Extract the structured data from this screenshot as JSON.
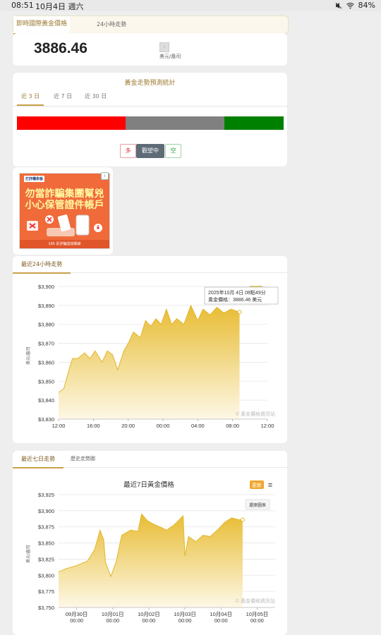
{
  "status_bar": {
    "time": "08:51",
    "date": "10月4日 週六",
    "battery": "84%"
  },
  "top_tabs": {
    "active": "即時國際黃金價格",
    "inactive": "24小時走勢"
  },
  "price": {
    "value": "3886.46",
    "unit": "美元/盎司",
    "unit_button": "›"
  },
  "prediction": {
    "title": "黃金走勢預測統計",
    "tabs": [
      "近 3 日",
      "近 7 日",
      "近 30 日"
    ],
    "active_tab": "近 3 日",
    "bar_colors": {
      "long": "#ff0000",
      "watch": "#808080",
      "short": "#008000"
    },
    "sentiment_buttons": {
      "long": "多",
      "watch": "觀望中",
      "short": "空"
    }
  },
  "ad": {
    "info_icon": "i",
    "top_text": "打詐儀表板",
    "headline_line1": "勿當詐騙集團幫兇",
    "headline_line2": "小心保管證件帳戶",
    "footer": "165 反詐騙諮詢專線"
  },
  "chart24": {
    "tab_label": "最近24小時走勢",
    "tooltip_line1": "2025年10月 4日 08點49分",
    "tooltip_line2": "黃金價格：3886.46 美元",
    "watermark": "© 黃金價格資訊站",
    "ylabel": "美元/盎司"
  },
  "chart7": {
    "tab_label": "最近七日走勢",
    "tab_label2": "歷史走勢圖",
    "title": "最近7日黃金價格",
    "update_button": "更新",
    "menu_icon": "≡",
    "reset_button": "還原圖表",
    "watermark": "© 黃金價格資訊站",
    "ylabel": "美元/盎司"
  },
  "chart_data": [
    {
      "type": "area",
      "ylim": [
        3830,
        3900
      ],
      "yticks": [
        "$3,830",
        "$3,840",
        "$3,850",
        "$3,860",
        "$3,870",
        "$3,880",
        "$3,890",
        "$3,900"
      ],
      "xlim": [
        0,
        24
      ],
      "xticks": [
        {
          "pos": 0,
          "label": "12:00"
        },
        {
          "pos": 4,
          "label": "16:00"
        },
        {
          "pos": 8,
          "label": "20:00"
        },
        {
          "pos": 12,
          "label": "00:00"
        },
        {
          "pos": 16,
          "label": "04:00"
        },
        {
          "pos": 20,
          "label": "08:00"
        },
        {
          "pos": 24,
          "label": "12:00"
        }
      ],
      "series": [
        {
          "x": [
            0,
            0.6,
            1.2,
            1.6,
            2.2,
            3,
            3.6,
            4.2,
            5,
            5.6,
            6.2,
            6.8,
            7.5,
            8,
            8.6,
            9.4,
            10,
            10.6,
            11.2,
            11.8,
            12.4,
            13,
            13.6,
            14.4,
            15.2,
            16,
            16.6,
            17.4,
            18.2,
            19,
            19.8,
            20.8
          ],
          "values": [
            3844,
            3846,
            3856,
            3862,
            3862,
            3865,
            3862,
            3866,
            3860,
            3866,
            3864,
            3856,
            3866,
            3870,
            3876,
            3873,
            3882,
            3879,
            3883,
            3880,
            3888,
            3880,
            3883,
            3880,
            3890,
            3882,
            3888,
            3885,
            3889,
            3886,
            3888,
            3886.46
          ]
        }
      ]
    },
    {
      "type": "area",
      "ylim": [
        3750,
        3925
      ],
      "yticks": [
        "$3,750",
        "$3,775",
        "$3,800",
        "$3,825",
        "$3,850",
        "$3,875",
        "$3,900",
        "$3,925"
      ],
      "xlim": [
        0,
        6
      ],
      "xticks": [
        {
          "pos": 0.5,
          "label": "09月30日",
          "label2": "00:00"
        },
        {
          "pos": 1.5,
          "label": "10月01日",
          "label2": "00:00"
        },
        {
          "pos": 2.5,
          "label": "10月02日",
          "label2": "00:00"
        },
        {
          "pos": 3.5,
          "label": "10月03日",
          "label2": "00:00"
        },
        {
          "pos": 4.5,
          "label": "10月04日",
          "label2": "00:00"
        },
        {
          "pos": 5.5,
          "label": "10月05日",
          "label2": "00:00"
        }
      ],
      "series": [
        {
          "x": [
            0,
            0.2,
            0.5,
            0.8,
            1.0,
            1.15,
            1.25,
            1.3,
            1.45,
            1.6,
            1.75,
            2.0,
            2.2,
            2.3,
            2.45,
            2.6,
            2.8,
            3.0,
            3.2,
            3.45,
            3.5,
            3.6,
            3.8,
            4.0,
            4.2,
            4.4,
            4.6,
            4.8,
            5.0,
            5.1
          ],
          "values": [
            3805,
            3810,
            3815,
            3822,
            3840,
            3870,
            3855,
            3820,
            3798,
            3822,
            3862,
            3870,
            3868,
            3895,
            3885,
            3880,
            3875,
            3870,
            3878,
            3892,
            3830,
            3860,
            3852,
            3862,
            3860,
            3870,
            3882,
            3889,
            3886,
            3886
          ]
        }
      ]
    }
  ]
}
